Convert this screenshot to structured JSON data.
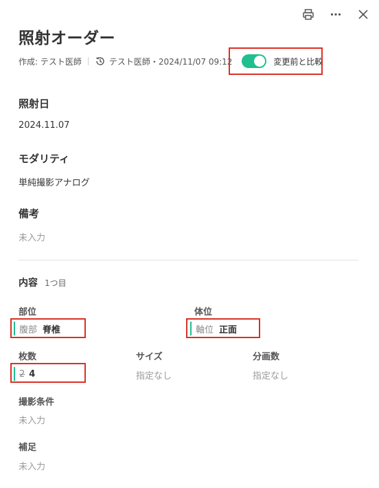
{
  "header": {
    "title": "照射オーダー",
    "icons": [
      "printer-icon",
      "more-icon",
      "close-icon"
    ]
  },
  "meta": {
    "author": "作成: テスト医師",
    "history_text": "テスト医師・2024/11/07 09:12",
    "compare_label": "変更前と比較",
    "compare_enabled": true,
    "toggle_color": "#1fbf8f"
  },
  "sections": {
    "date": {
      "label": "照射日",
      "value": "2024.11.07"
    },
    "modality": {
      "label": "モダリティ",
      "value": "単純撮影アナログ"
    },
    "notes": {
      "label": "備考",
      "value": "未入力"
    }
  },
  "content": {
    "heading": "内容",
    "sub": "1つ目",
    "fields": {
      "part": {
        "label": "部位",
        "old": "腹部",
        "new": "脊椎"
      },
      "position": {
        "label": "体位",
        "old": "軸位",
        "new": "正面"
      },
      "count": {
        "label": "枚数",
        "old": "2",
        "new": "4"
      },
      "size": {
        "label": "サイズ",
        "value": "指定なし"
      },
      "split": {
        "label": "分画数",
        "value": "指定なし"
      },
      "conditions": {
        "label": "撮影条件",
        "value": "未入力"
      },
      "supplement": {
        "label": "補足",
        "value": "未入力"
      }
    }
  },
  "highlight_color": "#d93025"
}
